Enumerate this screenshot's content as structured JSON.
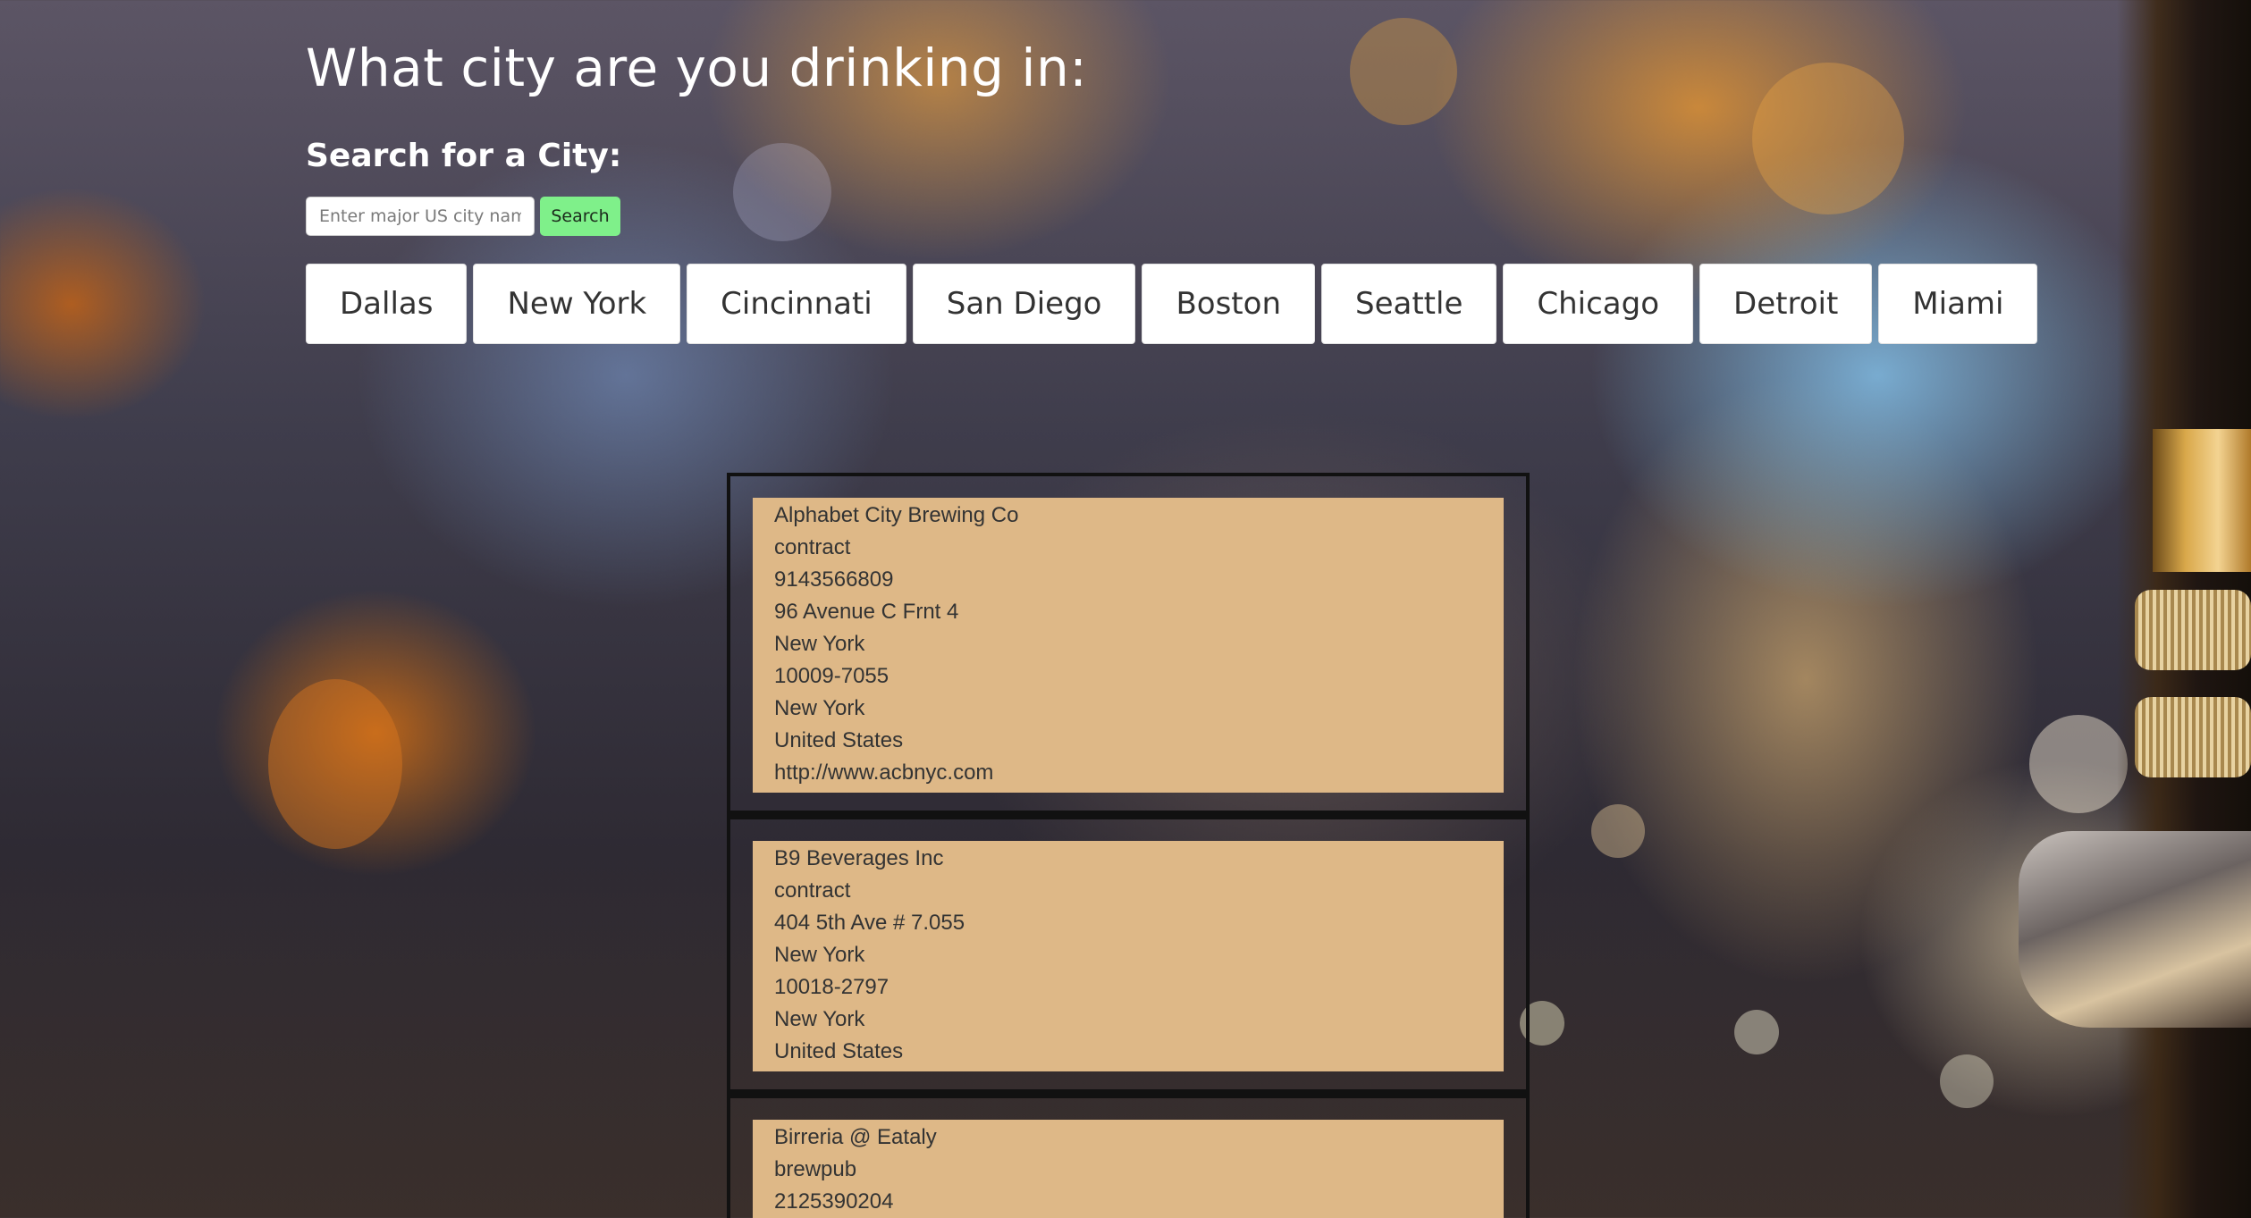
{
  "header": {
    "title": "What city are you drinking in:",
    "search_heading": "Search for a City:"
  },
  "search": {
    "placeholder": "Enter major US city name",
    "value": "",
    "button_label": "Search",
    "button_color": "#7ff08a"
  },
  "cities": [
    "Dallas",
    "New York",
    "Cincinnati",
    "San Diego",
    "Boston",
    "Seattle",
    "Chicago",
    "Detroit",
    "Miami"
  ],
  "breweries": [
    {
      "name": "Alphabet City Brewing Co",
      "type": "contract",
      "phone": "9143566809",
      "street": "96 Avenue C Frnt 4",
      "city": "New York",
      "postal_code": "10009-7055",
      "state": "New York",
      "country": "United States",
      "website": "http://www.acbnyc.com"
    },
    {
      "name": "B9 Beverages Inc",
      "type": "contract",
      "street": "404 5th Ave # 7.055",
      "city": "New York",
      "postal_code": "10018-2797",
      "state": "New York",
      "country": "United States"
    },
    {
      "name": "Birreria @ Eataly",
      "type": "brewpub",
      "phone": "2125390204"
    }
  ],
  "colors": {
    "card_background": "#deb887",
    "card_border": "#111111",
    "heading_text": "#ffffff"
  }
}
